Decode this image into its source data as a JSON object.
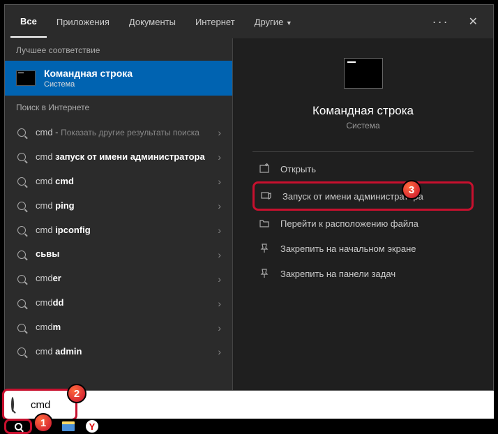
{
  "tabs": {
    "all": "Все",
    "apps": "Приложения",
    "documents": "Документы",
    "internet": "Интернет",
    "other": "Другие"
  },
  "sections": {
    "best_match": "Лучшее соответствие",
    "internet": "Поиск в Интернете"
  },
  "best_match": {
    "title": "Командная строка",
    "subtitle": "Система"
  },
  "internet_results": [
    {
      "prefix": "cmd",
      "bold": "",
      "suffix": " - ",
      "hint": "Показать другие результаты поиска"
    },
    {
      "prefix": "cmd ",
      "bold": "запуск от имени администратора",
      "suffix": "",
      "hint": ""
    },
    {
      "prefix": "cmd ",
      "bold": "cmd",
      "suffix": "",
      "hint": ""
    },
    {
      "prefix": "cmd ",
      "bold": "ping",
      "suffix": "",
      "hint": ""
    },
    {
      "prefix": "cmd ",
      "bold": "ipconfig",
      "suffix": "",
      "hint": ""
    },
    {
      "prefix": "",
      "bold": "сьвы",
      "suffix": "",
      "hint": ""
    },
    {
      "prefix": "cmd",
      "bold": "er",
      "suffix": "",
      "hint": ""
    },
    {
      "prefix": "cmd",
      "bold": "dd",
      "suffix": "",
      "hint": ""
    },
    {
      "prefix": "cmd",
      "bold": "m",
      "suffix": "",
      "hint": ""
    },
    {
      "prefix": "cmd ",
      "bold": "admin",
      "suffix": "",
      "hint": ""
    }
  ],
  "details": {
    "title": "Командная строка",
    "subtitle": "Система"
  },
  "actions": {
    "open": "Открыть",
    "run_as_admin": "Запуск от имени администратора",
    "open_location": "Перейти к расположению файла",
    "pin_start": "Закрепить на начальном экране",
    "pin_taskbar": "Закрепить на панели задач"
  },
  "search_input": "cmd",
  "steps": {
    "s1": "1",
    "s2": "2",
    "s3": "3"
  }
}
